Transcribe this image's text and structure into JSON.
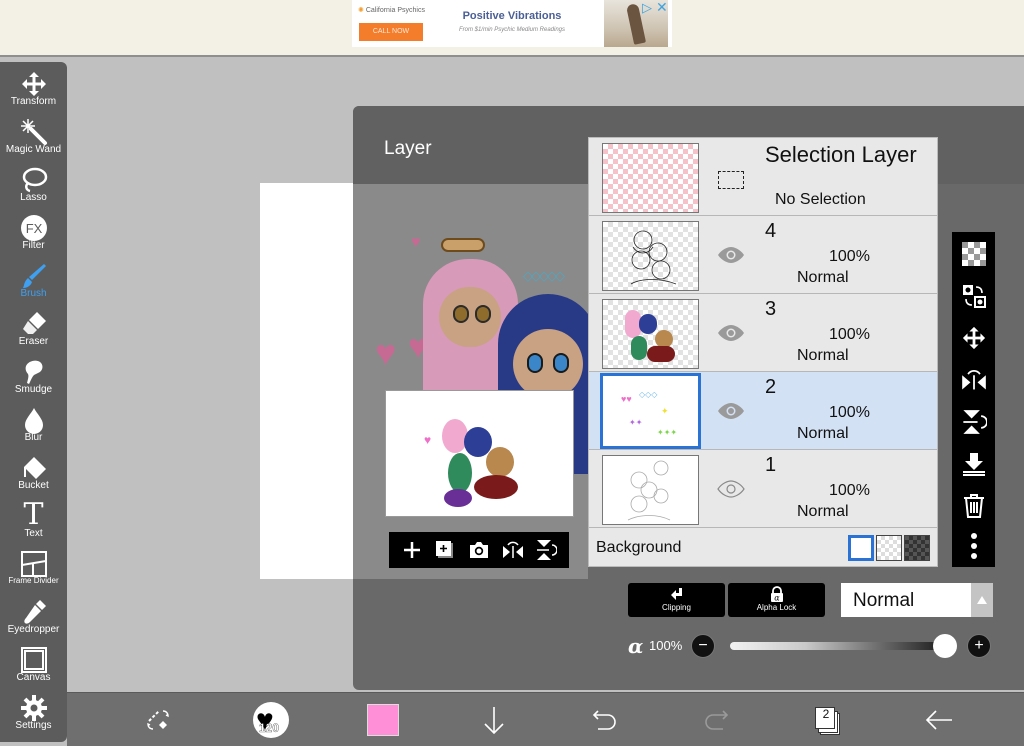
{
  "ad": {
    "brand": "California Psychics",
    "cta": "CALL NOW",
    "headline": "Positive Vibrations",
    "subline": "From $1/min Psychic Medium Readings",
    "adchoices_icon": "adchoices-icon",
    "close_icon": "close-icon"
  },
  "toolbar": {
    "items": [
      {
        "label": "Transform",
        "icon": "transform-icon"
      },
      {
        "label": "Magic Wand",
        "icon": "magic-wand-icon"
      },
      {
        "label": "Lasso",
        "icon": "lasso-icon"
      },
      {
        "label": "Filter",
        "icon": "fx-icon",
        "glyph": "FX"
      },
      {
        "label": "Brush",
        "icon": "brush-icon",
        "active": true
      },
      {
        "label": "Eraser",
        "icon": "eraser-icon"
      },
      {
        "label": "Smudge",
        "icon": "smudge-icon"
      },
      {
        "label": "Blur",
        "icon": "blur-drop-icon"
      },
      {
        "label": "Bucket",
        "icon": "bucket-icon"
      },
      {
        "label": "Text",
        "icon": "text-icon",
        "glyph": "T"
      },
      {
        "label": "Frame Divider",
        "icon": "frame-divider-icon"
      },
      {
        "label": "Eyedropper",
        "icon": "eyedropper-icon"
      },
      {
        "label": "Canvas",
        "icon": "canvas-icon"
      },
      {
        "label": "Settings",
        "icon": "gear-icon"
      }
    ],
    "active_color": "#3f9ff0"
  },
  "panel": {
    "title": "Layer",
    "selection_layer": {
      "title": "Selection Layer",
      "status": "No Selection"
    },
    "layers": [
      {
        "name": "4",
        "opacity": "100%",
        "blend": "Normal",
        "visible": true,
        "selected": false
      },
      {
        "name": "3",
        "opacity": "100%",
        "blend": "Normal",
        "visible": true,
        "selected": false
      },
      {
        "name": "2",
        "opacity": "100%",
        "blend": "Normal",
        "visible": true,
        "selected": true
      },
      {
        "name": "1",
        "opacity": "100%",
        "blend": "Normal",
        "visible": true,
        "selected": false
      }
    ],
    "background": {
      "label": "Background",
      "options": [
        "white",
        "transparent-light",
        "transparent-dark"
      ],
      "selected": "white"
    },
    "preview_actions": [
      "add-layer-icon",
      "duplicate-layer-icon",
      "camera-icon",
      "flip-horizontal-icon",
      "flip-vertical-icon"
    ],
    "side_actions": [
      "checker-icon",
      "swap-layers-icon",
      "move-icon",
      "flip-horizontal-icon",
      "flip-vertical-icon",
      "merge-down-icon",
      "trash-icon",
      "more-icon"
    ],
    "clipping_label": "Clipping",
    "alpha_lock_label": "Alpha Lock",
    "blend_mode": "Normal",
    "alpha_symbol": "α",
    "opacity_label": "100%",
    "opacity_value": 1.0,
    "selected_color": "#2a72d4"
  },
  "bottombar": {
    "brush_size": "120",
    "current_color": "#ff8fd6",
    "layer_count": "2",
    "items": [
      "transform-swap-icon",
      "brush-size-icon",
      "color-swatch",
      "arrow-down-icon",
      "undo-icon",
      "redo-icon",
      "layers-icon",
      "back-arrow-icon"
    ]
  }
}
